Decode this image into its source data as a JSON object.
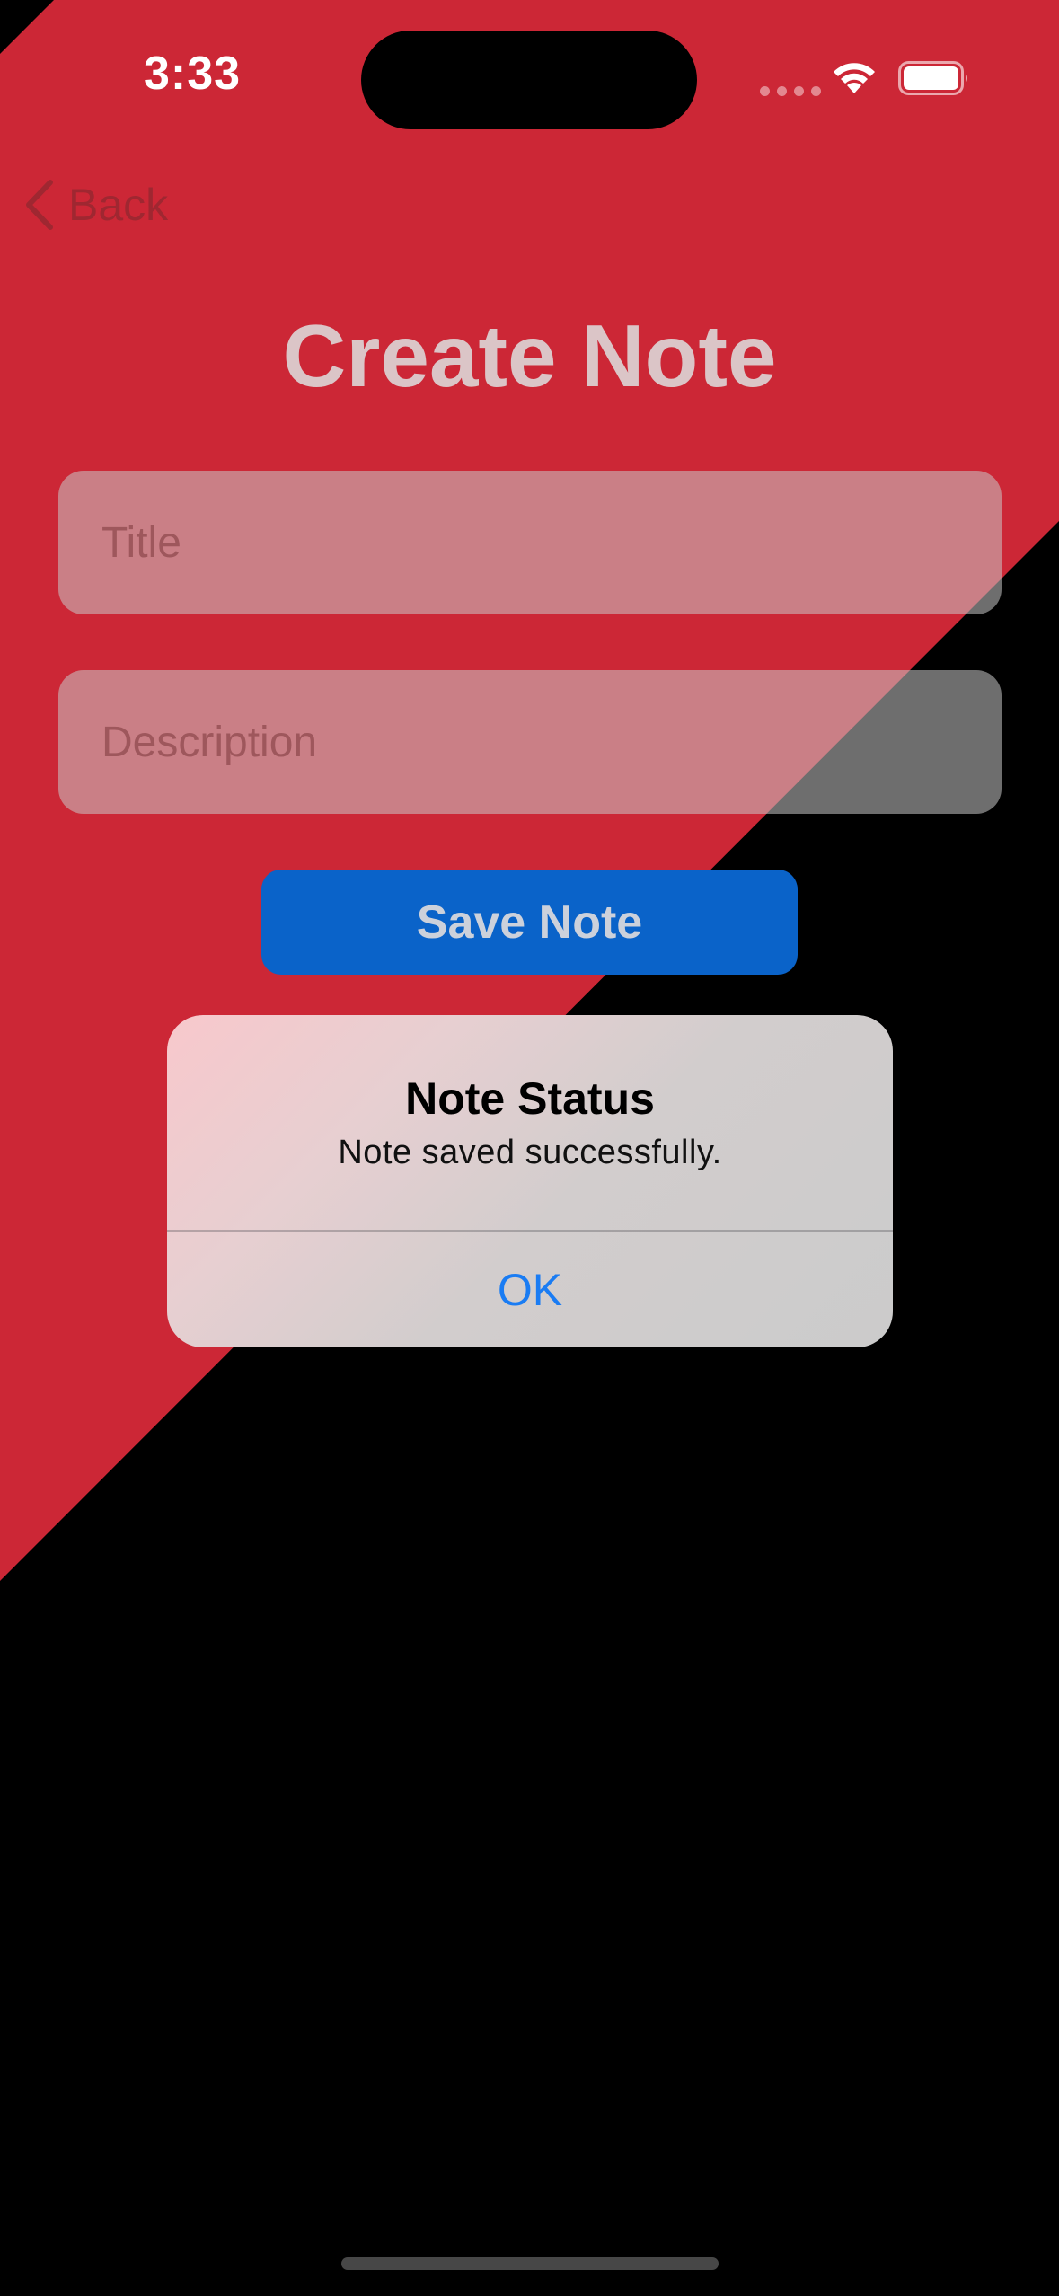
{
  "status_bar": {
    "time": "3:33",
    "icons": [
      "signal-dots-icon",
      "wifi-icon",
      "battery-icon"
    ]
  },
  "nav": {
    "back_label": "Back",
    "back_icon": "chevron-left-icon"
  },
  "page": {
    "title": "Create Note"
  },
  "form": {
    "title_field": {
      "placeholder": "Title",
      "value": ""
    },
    "description_field": {
      "placeholder": "Description",
      "value": ""
    },
    "save_label": "Save Note"
  },
  "alert": {
    "title": "Note Status",
    "message": "Note saved successfully.",
    "ok_label": "OK"
  },
  "colors": {
    "background_red": "#cc2736",
    "background_dark": "#000000",
    "button_blue": "#0a63c9",
    "alert_action_blue": "#1a7cf3"
  }
}
